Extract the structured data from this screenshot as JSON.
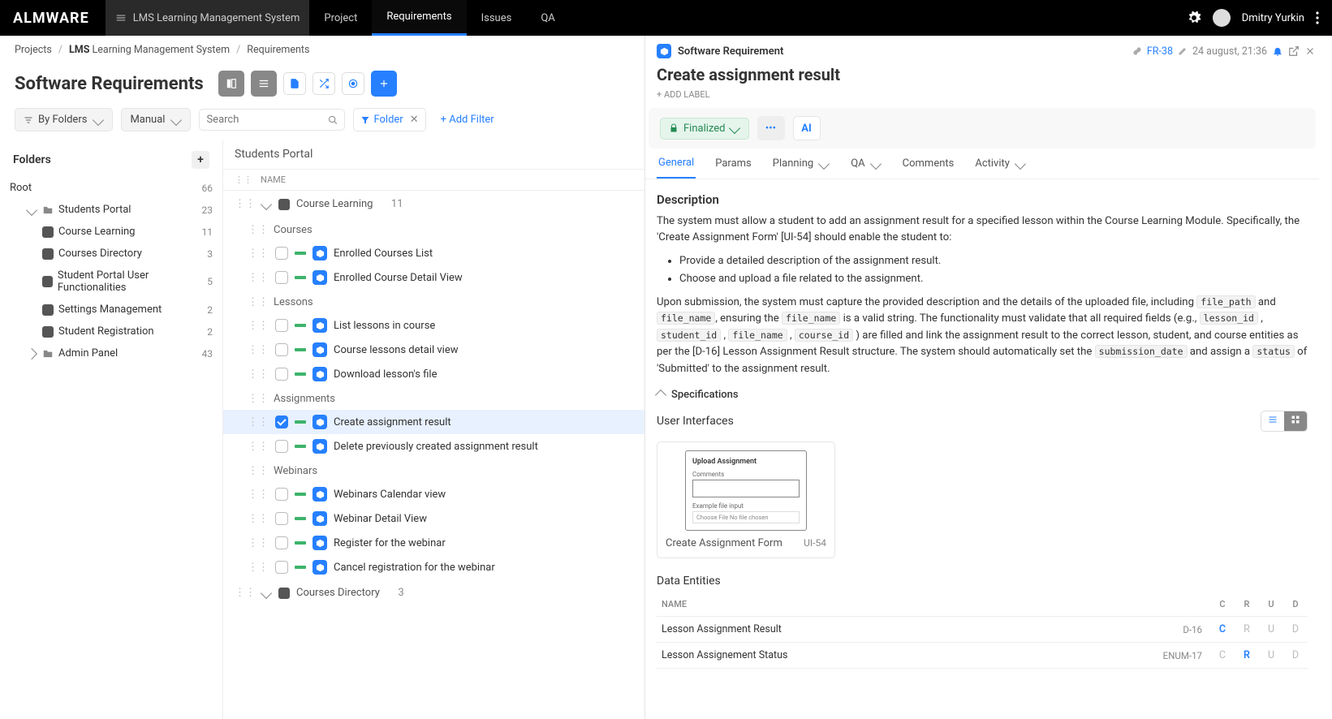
{
  "topbar": {
    "logo": "ALMWARE",
    "project": "LMS Learning Management System",
    "nav": [
      "Project",
      "Requirements",
      "Issues",
      "QA"
    ],
    "active_nav": 1,
    "user": "Dmitry Yurkin"
  },
  "breadcrumbs": [
    "Projects",
    "LMS Learning Management System",
    "Requirements"
  ],
  "page": {
    "title": "Software Requirements",
    "group_by": "By Folders",
    "sort": "Manual",
    "search_placeholder": "Search",
    "filter_label": "Folder",
    "add_filter": "+ Add Filter"
  },
  "folders": {
    "header": "Folders",
    "root_label": "Root",
    "root_count": 66,
    "tree": [
      {
        "name": "Students Portal",
        "count": 23,
        "expanded": true,
        "children": [
          {
            "name": "Course Learning",
            "count": 11
          },
          {
            "name": "Courses Directory",
            "count": 3
          },
          {
            "name": "Student Portal User Functionalities",
            "count": 5
          },
          {
            "name": "Settings Management",
            "count": 2
          },
          {
            "name": "Student Registration",
            "count": 2
          }
        ]
      },
      {
        "name": "Admin Panel",
        "count": 43,
        "expanded": false
      }
    ]
  },
  "list": {
    "context": "Students Portal",
    "col_name": "NAME",
    "groups": [
      {
        "name": "Course Learning",
        "count": 11,
        "sections": [
          {
            "title": "Courses",
            "items": [
              {
                "title": "Enrolled Courses List",
                "selected": false
              },
              {
                "title": "Enrolled Course Detail View",
                "selected": false
              }
            ]
          },
          {
            "title": "Lessons",
            "items": [
              {
                "title": "List lessons in course",
                "selected": false
              },
              {
                "title": "Course lessons detail view",
                "selected": false
              },
              {
                "title": "Download lesson's file",
                "selected": false
              }
            ]
          },
          {
            "title": "Assignments",
            "items": [
              {
                "title": "Create assignment result",
                "selected": true
              },
              {
                "title": "Delete previously created assignment result",
                "selected": false
              }
            ]
          },
          {
            "title": "Webinars",
            "items": [
              {
                "title": "Webinars Calendar view",
                "selected": false
              },
              {
                "title": "Webinar Detail View",
                "selected": false
              },
              {
                "title": "Register for the webinar",
                "selected": false
              },
              {
                "title": "Cancel registration for the webinar",
                "selected": false
              }
            ]
          }
        ]
      },
      {
        "name": "Courses Directory",
        "count": 3,
        "sections": []
      }
    ]
  },
  "detail": {
    "type_label": "Software Requirement",
    "key": "FR-38",
    "timestamp": "24 august, 21:36",
    "title": "Create assignment result",
    "add_label": "+ ADD LABEL",
    "status": "Finalized",
    "ai": "AI",
    "tabs": [
      "General",
      "Params",
      "Planning",
      "QA",
      "Comments",
      "Activity"
    ],
    "active_tab": 0,
    "description_heading": "Description",
    "description_intro": "The system must allow a student to add an assignment result for a specified lesson within the Course Learning Module. Specifically, the 'Create Assignment Form' [UI-54] should enable the student to:",
    "description_bullets": [
      "Provide a detailed description of the assignment result.",
      "Choose and upload a file related to the assignment."
    ],
    "description_rest_prefix": "Upon submission, the system must capture the provided description and the details of the uploaded file, including ",
    "code1": "file_path",
    "and1": " and ",
    "code2": "file_name",
    "rest2": ", ensuring the ",
    "code3": "file_name",
    "rest3": " is a valid string. The functionality must validate that all required fields (e.g., ",
    "code4": "lesson_id",
    "comma1": " , ",
    "code5": "student_id",
    "comma2": " , ",
    "code6": "file_name",
    "comma3": " , ",
    "code7": "course_id",
    "rest4": " ) are filled and link the assignment result to the correct lesson, student, and course entities as per the [D-16] Lesson Assignment Result structure. The system should automatically set the ",
    "code8": "submission_date",
    "rest5": " and assign a ",
    "code9": "status",
    "rest6": " of 'Submitted' to the assignment result.",
    "specifications": "Specifications",
    "ui_heading": "User Interfaces",
    "ui_card": {
      "preview_title": "Upload Assignment",
      "preview_label1": "Comments",
      "preview_label2": "Example file input",
      "preview_file": "Choose File   No file chosen",
      "name": "Create Assignment Form",
      "id": "UI-54"
    },
    "de_heading": "Data Entities",
    "de_cols": {
      "name": "NAME",
      "c": "C",
      "r": "R",
      "u": "U",
      "d": "D"
    },
    "de_rows": [
      {
        "name": "Lesson Assignment Result",
        "id": "D-16",
        "c": true,
        "r": false,
        "u": false,
        "d": false
      },
      {
        "name": "Lesson Assignement Status",
        "id": "ENUM-17",
        "c": false,
        "r": true,
        "u": false,
        "d": false
      }
    ]
  }
}
